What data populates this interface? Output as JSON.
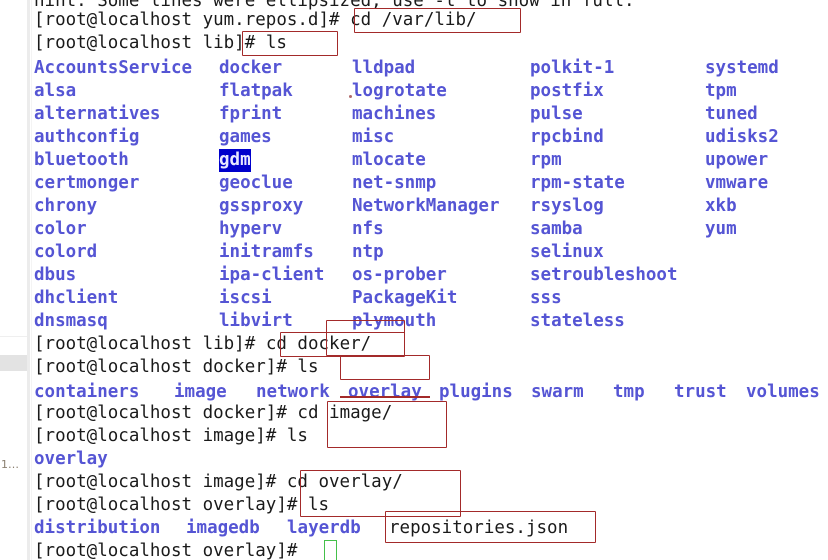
{
  "terminal": {
    "hint_line": "hint: Some lines were ellipsized, use -l to show in full.",
    "gutter_marker": "1…",
    "colors": {
      "background": "#ffffff",
      "directory_text": "#5555d4",
      "prompt_text": "#1a1a1a",
      "selection_bg": "#0000cc",
      "selection_fg": "#e8e8ff",
      "annotation_red": "#a32a2a",
      "cursor_green": "#44c04a"
    },
    "prompts": {
      "p1": "[root@localhost yum.repos.d]#",
      "p2": "[root@localhost lib]#",
      "p3": "[root@localhost lib]#",
      "p4": "[root@localhost docker]#",
      "p5": "[root@localhost docker]#",
      "p6": "[root@localhost image]#",
      "p7": "[root@localhost image]#",
      "p8": "[root@localhost overlay]#",
      "p9": "[root@localhost overlay]#"
    },
    "commands": {
      "c1": "cd /var/lib/",
      "c2": "ls",
      "c3": "cd docker/",
      "c4": "ls",
      "c5": "cd image/",
      "c6": "ls",
      "c7": "cd overlay/",
      "c8": "ls",
      "c9": ""
    },
    "var_lib_listing": {
      "columns": [
        [
          "AccountsService",
          "alsa",
          "alternatives",
          "authconfig",
          "bluetooth",
          "certmonger",
          "chrony",
          "color",
          "colord",
          "dbus",
          "dhclient",
          "dnsmasq"
        ],
        [
          "docker",
          "flatpak",
          "fprint",
          "games",
          "gdm",
          "geoclue",
          "gssproxy",
          "hyperv",
          "initramfs",
          "ipa-client",
          "iscsi",
          "libvirt"
        ],
        [
          "lldpad",
          "logrotate",
          "machines",
          "misc",
          "mlocate",
          "net-snmp",
          "NetworkManager",
          "nfs",
          "ntp",
          "os-prober",
          "PackageKit",
          "plymouth"
        ],
        [
          "polkit-1",
          "postfix",
          "pulse",
          "rpcbind",
          "rpm",
          "rpm-state",
          "rsyslog",
          "samba",
          "selinux",
          "setroubleshoot",
          "sss",
          "stateless"
        ],
        [
          "systemd",
          "tpm",
          "tuned",
          "udisks2",
          "upower",
          "vmware",
          "xkb",
          "yum"
        ]
      ],
      "selected_item": "gdm"
    },
    "docker_listing": [
      "containers",
      "image",
      "network",
      "overlay",
      "plugins",
      "swarm",
      "tmp",
      "trust",
      "volumes"
    ],
    "docker_listing_underlined": "overlay",
    "image_listing": [
      "overlay"
    ],
    "overlay_listing": [
      "distribution",
      "imagedb",
      "layerdb",
      "repositories.json"
    ],
    "overlay_listing_file": "repositories.json"
  }
}
